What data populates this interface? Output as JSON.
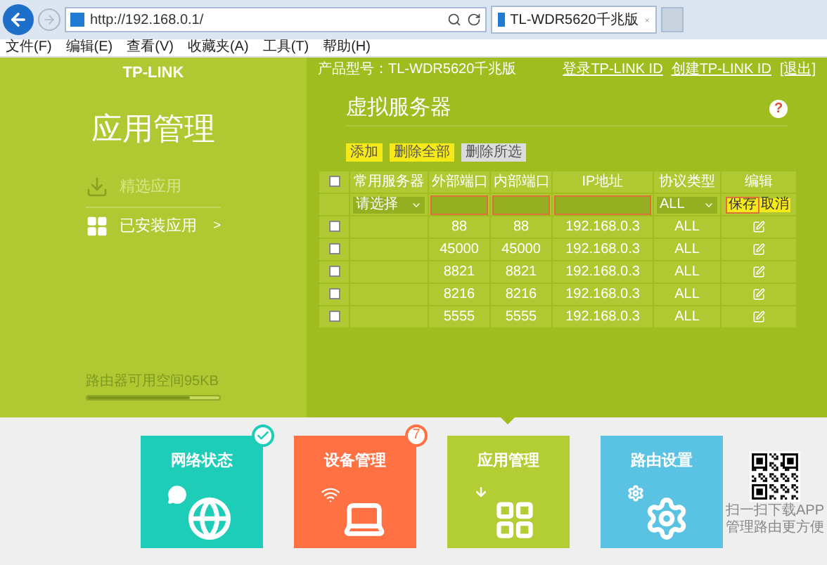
{
  "browser": {
    "url": "http://192.168.0.1/",
    "tab_title": "TL-WDR5620千兆版",
    "menu": [
      "文件(F)",
      "编辑(E)",
      "查看(V)",
      "收藏夹(A)",
      "工具(T)",
      "帮助(H)"
    ]
  },
  "header": {
    "logo": "TP-LINK",
    "model": "产品型号：TL-WDR5620千兆版",
    "links": [
      "登录TP-LINK ID",
      "创建TP-LINK ID",
      "[退出]"
    ]
  },
  "sidebar": {
    "title": "应用管理",
    "items": [
      {
        "label": "精选应用",
        "kind": "download",
        "selected": false
      },
      {
        "label": "已安装应用",
        "kind": "grid",
        "selected": true,
        "arrow": ">"
      }
    ],
    "storage": {
      "label": "路由器可用空间95KB",
      "level": 0.78
    }
  },
  "main": {
    "title": "虚拟服务器",
    "help": "?",
    "buttons": [
      {
        "label": "添加",
        "kind": "primary"
      },
      {
        "label": "删除全部",
        "kind": "primary"
      },
      {
        "label": "删除所选",
        "kind": "secondary"
      }
    ],
    "table": {
      "header_checked": false,
      "columns": [
        "常用服务器",
        "外部端口",
        "内部端口",
        "IP地址",
        "协议类型",
        "编辑"
      ],
      "edit_row": {
        "server": "请选择",
        "external_invalid": true,
        "internal_invalid": true,
        "ip_invalid": true,
        "protocol": "ALL",
        "save": "保存",
        "cancel": "取消"
      },
      "rows": [
        {
          "checked": false,
          "external": "88",
          "internal": "88",
          "ip": "192.168.0.3",
          "protocol": "ALL"
        },
        {
          "checked": false,
          "external": "45000",
          "internal": "45000",
          "ip": "192.168.0.3",
          "protocol": "ALL"
        },
        {
          "checked": false,
          "external": "8821",
          "internal": "8821",
          "ip": "192.168.0.3",
          "protocol": "ALL"
        },
        {
          "checked": false,
          "external": "8216",
          "internal": "8216",
          "ip": "192.168.0.3",
          "protocol": "ALL"
        },
        {
          "checked": false,
          "external": "5555",
          "internal": "5555",
          "ip": "192.168.0.3",
          "protocol": "ALL"
        }
      ]
    }
  },
  "nav": [
    {
      "label": "网络状态",
      "kind": "globe",
      "color": "#1ecdb8",
      "checked": true,
      "selected": false
    },
    {
      "label": "设备管理",
      "kind": "laptop",
      "color": "#ff7043",
      "badge": "7",
      "selected": false
    },
    {
      "label": "应用管理",
      "kind": "apps",
      "color": "#b3ce34",
      "selected": true
    },
    {
      "label": "路由设置",
      "kind": "gear",
      "color": "#5ac3e4",
      "selected": false
    }
  ],
  "qr": {
    "caption": [
      "扫一扫下载APP",
      "管理路由更方便"
    ]
  }
}
